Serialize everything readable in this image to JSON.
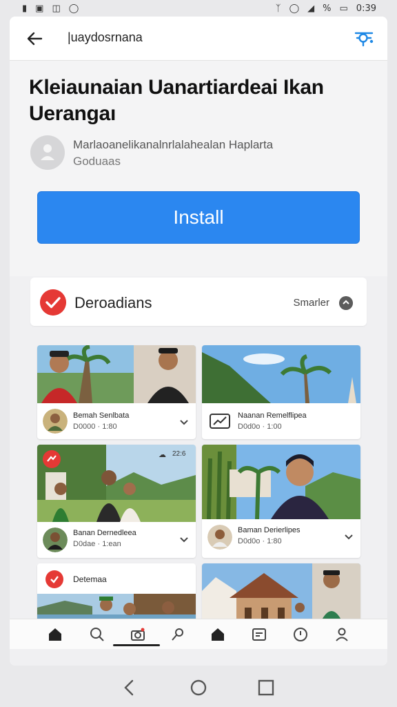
{
  "status_bar": {
    "left_icons": [
      "notification-icon",
      "image-icon",
      "battery-saver-icon",
      "location-icon"
    ],
    "right_icons": [
      "bluetooth-icon",
      "alarm-icon",
      "signal-icon"
    ],
    "battery_text": "%",
    "time": "0:39"
  },
  "app_bar": {
    "back_icon": "back-arrow-icon",
    "title": "|uaydosrnana",
    "share_icon": "share-icon"
  },
  "app": {
    "title": "Kleiaunaian Uanartiardeai Ikan Uerangaı",
    "developer_line1": "Marlaoanelikanalnrlalahealan Haplarta",
    "developer_line2": "Goduaas",
    "install_label": "Install"
  },
  "section": {
    "title": "Deroadians",
    "action_label": "Smarler"
  },
  "tiles": [
    {
      "title": "Bemah Senlbata",
      "subtitle": "D0000 · 1:80"
    },
    {
      "title": "Naanan Remelflipea",
      "subtitle": "D0d0o · 1:00"
    },
    {
      "title": "Banan Dernedleea",
      "subtitle": "D0dae · 1:ean",
      "timestamp": "22:6"
    },
    {
      "title": "Baman Derierlipes",
      "subtitle": "D0d0o · 1:80"
    },
    {
      "title": "Detemaa"
    }
  ],
  "colors": {
    "install_blue": "#2b87f0",
    "badge_red": "#e53935",
    "background": "#e9e9eb"
  },
  "bottom_tabs": [
    "home-icon",
    "search-icon",
    "camera-icon",
    "pin-icon",
    "home-icon",
    "store-icon",
    "shield-icon",
    "profile-icon"
  ]
}
